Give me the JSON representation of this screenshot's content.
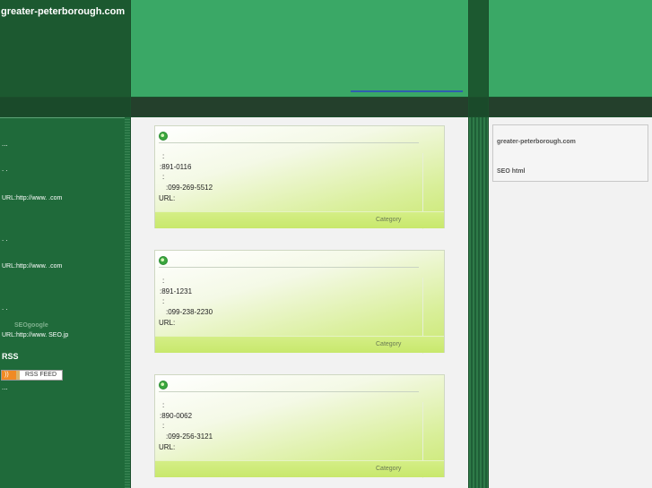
{
  "site_title": "greater-peterborough.com",
  "sidebar": {
    "line1": "...",
    "line2": ".      .",
    "url1": "URL:http://www.      .com",
    "line3": ".      .",
    "url2": "URL:http://www.      .com",
    "line4": ".      .",
    "seogoogle": "SEOgoogle",
    "url3": "URL:http://www.      SEO.jp",
    "rss_heading": "RSS",
    "rss_button_label": "RSS FEED",
    "footer_dots": "..."
  },
  "cards": [
    {
      "colon1": ":",
      "postal": ":891-0116",
      "colon2": ":",
      "phone": ":099-269-5512",
      "url": "URL:",
      "category": "Category"
    },
    {
      "colon1": ":",
      "postal": ":891-1231",
      "colon2": ":",
      "phone": ":099-238-2230",
      "url": "URL:",
      "category": "Category"
    },
    {
      "colon1": ":",
      "postal": ":890-0062",
      "colon2": ":",
      "phone": ":099-256-3121",
      "url": "URL:",
      "category": "Category"
    }
  ],
  "right_panel": {
    "site": "greater-peterborough.com",
    "seo": "SEO html"
  },
  "colors": {
    "header_green": "#3aa866",
    "dark_green": "#1c5930",
    "card_foot": "#c8e86c"
  }
}
